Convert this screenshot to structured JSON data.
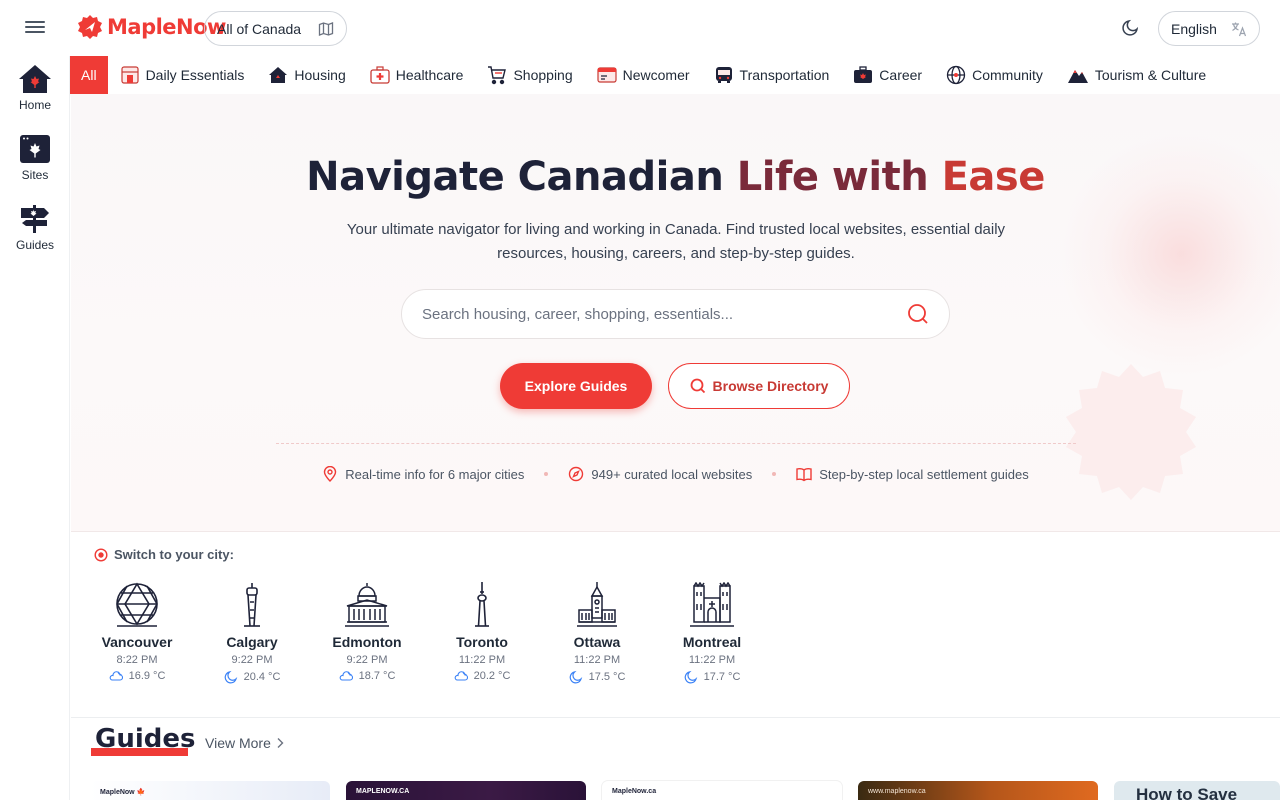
{
  "header": {
    "brand": "MapleNow",
    "region": "All of Canada",
    "language": "English"
  },
  "sidebar": {
    "items": [
      {
        "label": "Home",
        "icon": "home-icon"
      },
      {
        "label": "Sites",
        "icon": "sites-icon"
      },
      {
        "label": "Guides",
        "icon": "guides-icon"
      }
    ]
  },
  "categories": [
    {
      "label": "All",
      "icon": "",
      "active": true
    },
    {
      "label": "Daily Essentials",
      "icon": "store-icon"
    },
    {
      "label": "Housing",
      "icon": "house-icon"
    },
    {
      "label": "Healthcare",
      "icon": "medical-kit-icon"
    },
    {
      "label": "Shopping",
      "icon": "cart-icon"
    },
    {
      "label": "Newcomer",
      "icon": "id-card-icon"
    },
    {
      "label": "Transportation",
      "icon": "bus-icon"
    },
    {
      "label": "Career",
      "icon": "briefcase-icon"
    },
    {
      "label": "Community",
      "icon": "globe-icon"
    },
    {
      "label": "Tourism & Culture",
      "icon": "mountain-icon"
    }
  ],
  "hero": {
    "title_part1": "Navigate Canadian",
    "title_part2": "Life with",
    "title_part3": "Ease",
    "subtitle": "Your ultimate navigator for living and working in Canada. Find trusted local websites, essential daily resources, housing, careers, and step-by-step guides.",
    "search_placeholder": "Search housing, career, shopping, essentials...",
    "primary_button": "Explore Guides",
    "secondary_button": "Browse Directory",
    "features": [
      "Real-time info for 6 major cities",
      "949+ curated local websites",
      "Step-by-step local settlement guides"
    ]
  },
  "cities": {
    "heading": "Switch to your city:",
    "list": [
      {
        "name": "Vancouver",
        "time": "8:22 PM",
        "temp": "16.9 °C",
        "weather": "cloudy-night-icon"
      },
      {
        "name": "Calgary",
        "time": "9:22 PM",
        "temp": "20.4 °C",
        "weather": "moon-icon"
      },
      {
        "name": "Edmonton",
        "time": "9:22 PM",
        "temp": "18.7 °C",
        "weather": "cloudy-night-icon"
      },
      {
        "name": "Toronto",
        "time": "11:22 PM",
        "temp": "20.2 °C",
        "weather": "cloudy-night-icon"
      },
      {
        "name": "Ottawa",
        "time": "11:22 PM",
        "temp": "17.5 °C",
        "weather": "moon-icon"
      },
      {
        "name": "Montreal",
        "time": "11:22 PM",
        "temp": "17.7 °C",
        "weather": "moon-icon"
      }
    ]
  },
  "guides": {
    "title": "Guides",
    "view_more": "View More",
    "cards": [
      {
        "label": "MapleNow 🍁"
      },
      {
        "label": "MAPLENOW.CA"
      },
      {
        "label": "MapleNow.ca"
      },
      {
        "label": "www.maplenow.ca"
      },
      {
        "label": "How to Save"
      }
    ]
  },
  "colors": {
    "accent": "#ef3b36",
    "navy": "#1e2238"
  }
}
